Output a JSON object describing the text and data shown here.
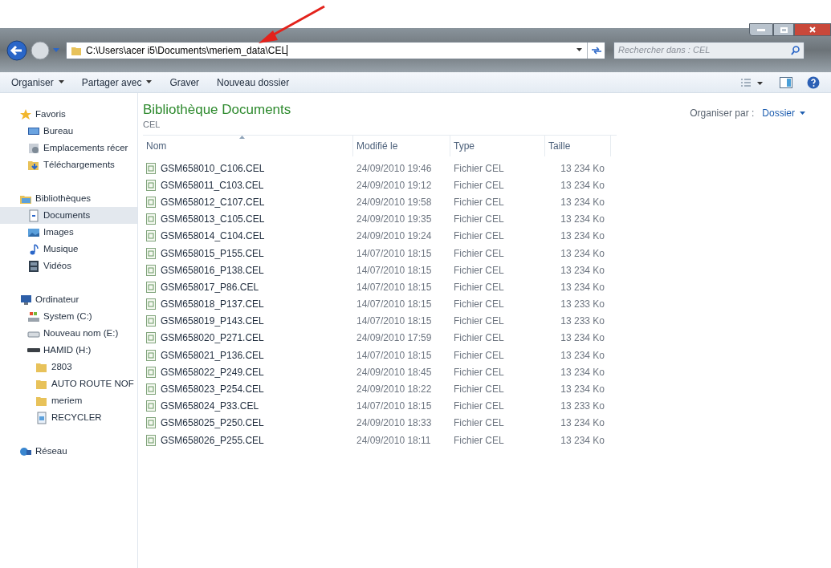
{
  "address_bar": {
    "path": "C:\\Users\\acer i5\\Documents\\meriem_data\\CEL"
  },
  "search": {
    "placeholder": "Rechercher dans : CEL"
  },
  "toolbar": {
    "buttons": [
      {
        "label": "Organiser",
        "dropdown": true
      },
      {
        "label": "Partager avec",
        "dropdown": true
      },
      {
        "label": "Graver",
        "dropdown": false
      },
      {
        "label": "Nouveau dossier",
        "dropdown": false
      }
    ]
  },
  "sidebar": {
    "items": [
      {
        "label": "Favoris",
        "kind": "star",
        "selected": false,
        "children": [
          {
            "label": "Bureau",
            "kind": "desktop",
            "selected": false
          },
          {
            "label": "Emplacements récer",
            "kind": "recent",
            "selected": false
          },
          {
            "label": "Téléchargements",
            "kind": "downloads",
            "selected": false
          }
        ]
      },
      {
        "label": "Bibliothèques",
        "kind": "library",
        "selected": false,
        "children": [
          {
            "label": "Documents",
            "kind": "document",
            "selected": true
          },
          {
            "label": "Images",
            "kind": "images",
            "selected": false
          },
          {
            "label": "Musique",
            "kind": "music",
            "selected": false
          },
          {
            "label": "Vidéos",
            "kind": "videos",
            "selected": false
          }
        ]
      },
      {
        "label": "Ordinateur",
        "kind": "computer",
        "selected": false,
        "children": [
          {
            "label": "System (C:)",
            "kind": "system_drive",
            "selected": false
          },
          {
            "label": "Nouveau nom (E:)",
            "kind": "drive",
            "selected": false
          },
          {
            "label": "HAMID (H:)",
            "kind": "usb",
            "selected": false,
            "children": [
              {
                "label": "2803",
                "kind": "folder",
                "selected": false
              },
              {
                "label": "AUTO ROUTE NOF",
                "kind": "folder",
                "selected": false
              },
              {
                "label": "meriem",
                "kind": "folder",
                "selected": false
              },
              {
                "label": "RECYCLER",
                "kind": "recycler",
                "selected": false
              }
            ]
          }
        ]
      },
      {
        "label": "Réseau",
        "kind": "network",
        "selected": false
      }
    ]
  },
  "library": {
    "title": "Bibliothèque Documents",
    "subtitle": "CEL",
    "arrange_label": "Organiser par :",
    "arrange_value": "Dossier"
  },
  "table": {
    "columns": [
      "Nom",
      "Modifié le",
      "Type",
      "Taille"
    ],
    "rows": [
      [
        "GSM658010_C106.CEL",
        "24/09/2010 19:46",
        "Fichier CEL",
        "13 234 Ko"
      ],
      [
        "GSM658011_C103.CEL",
        "24/09/2010 19:12",
        "Fichier CEL",
        "13 234 Ko"
      ],
      [
        "GSM658012_C107.CEL",
        "24/09/2010 19:58",
        "Fichier CEL",
        "13 234 Ko"
      ],
      [
        "GSM658013_C105.CEL",
        "24/09/2010 19:35",
        "Fichier CEL",
        "13 234 Ko"
      ],
      [
        "GSM658014_C104.CEL",
        "24/09/2010 19:24",
        "Fichier CEL",
        "13 234 Ko"
      ],
      [
        "GSM658015_P155.CEL",
        "14/07/2010 18:15",
        "Fichier CEL",
        "13 234 Ko"
      ],
      [
        "GSM658016_P138.CEL",
        "14/07/2010 18:15",
        "Fichier CEL",
        "13 234 Ko"
      ],
      [
        "GSM658017_P86.CEL",
        "14/07/2010 18:15",
        "Fichier CEL",
        "13 234 Ko"
      ],
      [
        "GSM658018_P137.CEL",
        "14/07/2010 18:15",
        "Fichier CEL",
        "13 233 Ko"
      ],
      [
        "GSM658019_P143.CEL",
        "14/07/2010 18:15",
        "Fichier CEL",
        "13 233 Ko"
      ],
      [
        "GSM658020_P271.CEL",
        "24/09/2010 17:59",
        "Fichier CEL",
        "13 234 Ko"
      ],
      [
        "GSM658021_P136.CEL",
        "14/07/2010 18:15",
        "Fichier CEL",
        "13 234 Ko"
      ],
      [
        "GSM658022_P249.CEL",
        "24/09/2010 18:45",
        "Fichier CEL",
        "13 234 Ko"
      ],
      [
        "GSM658023_P254.CEL",
        "24/09/2010 18:22",
        "Fichier CEL",
        "13 234 Ko"
      ],
      [
        "GSM658024_P33.CEL",
        "14/07/2010 18:15",
        "Fichier CEL",
        "13 233 Ko"
      ],
      [
        "GSM658025_P250.CEL",
        "24/09/2010 18:33",
        "Fichier CEL",
        "13 234 Ko"
      ],
      [
        "GSM658026_P255.CEL",
        "24/09/2010 18:11",
        "Fichier CEL",
        "13 234 Ko"
      ]
    ]
  }
}
